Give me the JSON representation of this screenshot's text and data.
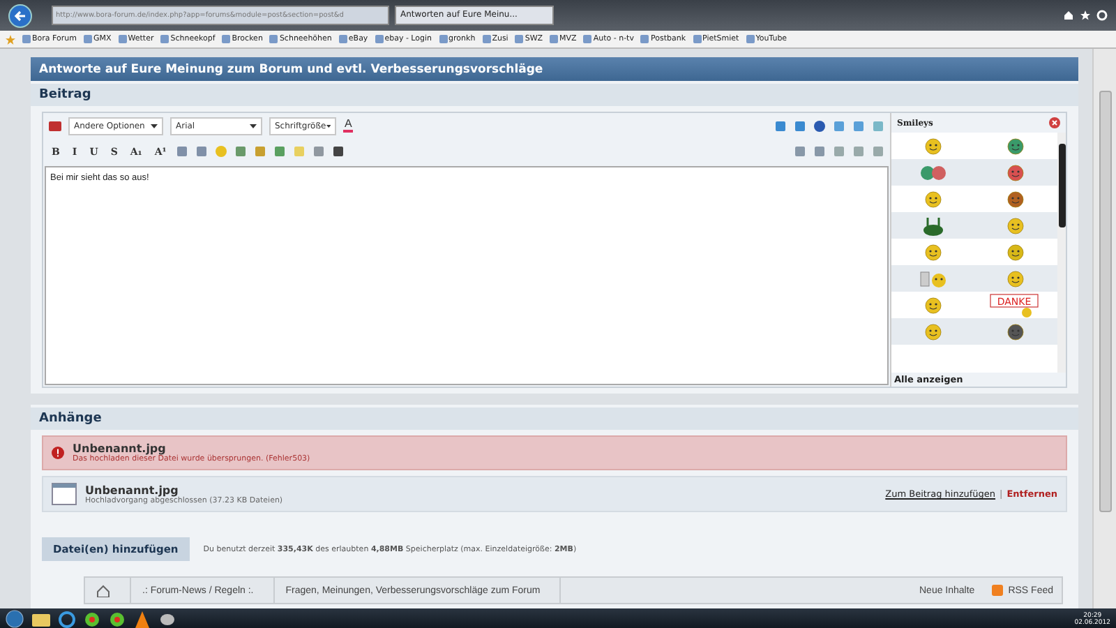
{
  "browser": {
    "address": "http://www.bora-forum.de/index.php?app=forums&module=post&section=post&d",
    "tabs": [
      {
        "label": "Antworten auf Eure Meinu...",
        "selected": true
      }
    ]
  },
  "bookmarks": [
    "Bora Forum",
    "GMX",
    "Wetter",
    "Schneekopf",
    "Brocken",
    "Schneehöhen",
    "eBay",
    "ebay - Login",
    "gronkh",
    "Zusi",
    "SWZ",
    "MVZ",
    "Auto - n-tv",
    "Postbank",
    "PietSmiet",
    "YouTube"
  ],
  "page_title": "Antworte auf Eure Meinung zum Borum und evtl. Verbesserungsvorschläge",
  "post": {
    "heading": "Beitrag",
    "dropdowns": [
      "Andere Optionen",
      "Arial",
      "Schriftgröße"
    ],
    "font_color_label": "A",
    "format_buttons": [
      "B",
      "I",
      "U",
      "S",
      "A₁",
      "A¹"
    ],
    "text": "Bei mir sieht das so aus!"
  },
  "smileys": {
    "title": "Smileys",
    "sign_text": "DANKE",
    "show_all": "Alle anzeigen"
  },
  "attachments": {
    "heading": "Anhänge",
    "files": [
      {
        "name": "Unbenannt.jpg",
        "status": "Das hochladen dieser Datei wurde übersprungen. (Fehler503)",
        "kind": "error"
      },
      {
        "name": "Unbenannt.jpg",
        "status": "Hochladvorgang abgeschlossen (37.23 KB Dateien)",
        "kind": "done",
        "actions": [
          "Zum Beitrag hinzufügen",
          "Entfernen"
        ],
        "separator": "|"
      }
    ],
    "add_button": "Datei(en) hinzufügen",
    "usage": "Du benutzt derzeit **335,43K** des erlaubten **4,88MB** Speicherplatz (max. Einzeldateigröße: **2MB**)"
  },
  "breadcrumb": {
    "items": [
      ".: Forum-News / Regeln :.",
      "Fragen, Meinungen, Verbesserungsvorschläge zum Forum"
    ],
    "links": [
      "Neue Inhalte",
      "RSS Feed"
    ]
  },
  "taskbar": {
    "time": "20:29",
    "date": "02.06.2012"
  }
}
